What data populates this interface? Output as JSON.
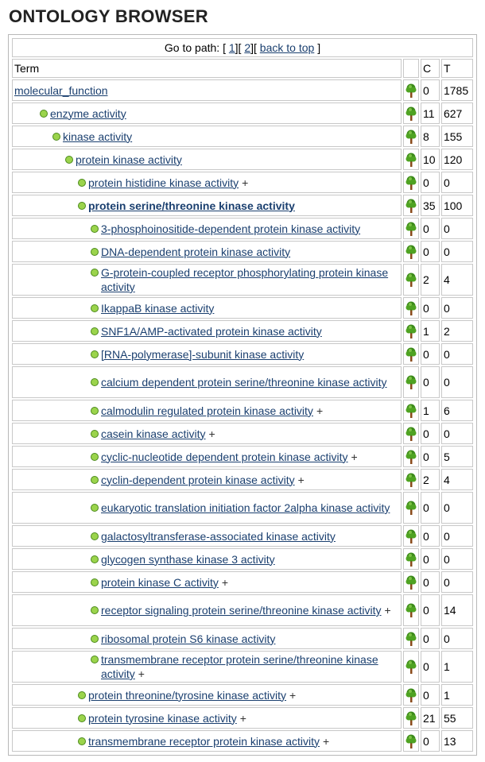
{
  "page_title": "ONTOLOGY BROWSER",
  "goto": {
    "prefix": "Go to path: [",
    "link1": "1",
    "sep1": "][",
    "link2": "2",
    "sep2": "][",
    "back": "back to top",
    "suffix": "]"
  },
  "headers": {
    "term": "Term",
    "tree": "",
    "c": "C",
    "t": "T"
  },
  "rows": [
    {
      "label": "molecular_function",
      "c": "0",
      "t": "1785"
    },
    {
      "label": "enzyme activity",
      "c": "11",
      "t": "627"
    },
    {
      "label": "kinase activity",
      "c": "8",
      "t": "155"
    },
    {
      "label": "protein kinase activity",
      "c": "10",
      "t": "120"
    },
    {
      "label": "protein histidine kinase activity",
      "plus": "+",
      "c": "0",
      "t": "0"
    },
    {
      "label": "protein serine/threonine kinase activity",
      "c": "35",
      "t": "100"
    },
    {
      "label": "3-phosphoinositide-dependent protein kinase activity",
      "c": "0",
      "t": "0"
    },
    {
      "label": "DNA-dependent protein kinase activity",
      "c": "0",
      "t": "0"
    },
    {
      "label": "G-protein-coupled receptor phosphorylating protein kinase activity",
      "c": "2",
      "t": "4"
    },
    {
      "label": "IkappaB kinase activity",
      "c": "0",
      "t": "0"
    },
    {
      "label": "SNF1A/AMP-activated protein kinase activity",
      "c": "1",
      "t": "2"
    },
    {
      "label": "[RNA-polymerase]-subunit kinase activity",
      "c": "0",
      "t": "0"
    },
    {
      "label": "calcium dependent protein serine/threonine kinase activity",
      "c": "0",
      "t": "0"
    },
    {
      "label": "calmodulin regulated protein kinase activity",
      "plus": "+",
      "c": "1",
      "t": "6"
    },
    {
      "label": "casein kinase activity",
      "plus": "+",
      "c": "0",
      "t": "0"
    },
    {
      "label": "cyclic-nucleotide dependent protein kinase activity",
      "plus": "+",
      "c": "0",
      "t": "5"
    },
    {
      "label": "cyclin-dependent protein kinase activity",
      "plus": "+",
      "c": "2",
      "t": "4"
    },
    {
      "label": "eukaryotic translation initiation factor 2alpha kinase activity",
      "c": "0",
      "t": "0"
    },
    {
      "label": "galactosyltransferase-associated kinase activity",
      "c": "0",
      "t": "0"
    },
    {
      "label": "glycogen synthase kinase 3 activity",
      "c": "0",
      "t": "0"
    },
    {
      "label": "protein kinase C activity",
      "plus": "+",
      "c": "0",
      "t": "0"
    },
    {
      "label": "receptor signaling protein serine/threonine kinase activity",
      "plus": "+",
      "c": "0",
      "t": "14"
    },
    {
      "label": "ribosomal protein S6 kinase activity",
      "c": "0",
      "t": "0"
    },
    {
      "label": "transmembrane receptor protein serine/threonine kinase activity",
      "plus": "+",
      "c": "0",
      "t": "1"
    },
    {
      "label": "protein threonine/tyrosine kinase activity",
      "plus": "+",
      "c": "0",
      "t": "1"
    },
    {
      "label": "protein tyrosine kinase activity",
      "plus": "+",
      "c": "21",
      "t": "55"
    },
    {
      "label": "transmembrane receptor protein kinase activity",
      "plus": "+",
      "c": "0",
      "t": "13"
    }
  ],
  "colors": {
    "link": "#1a3f6f",
    "border": "#c8c8c8",
    "tree_green": "#3c8a1a",
    "tree_trunk": "#8a4a1a",
    "info_green": "#9bd44c"
  },
  "icons": {
    "tree": "tree-icon",
    "info": "info-icon"
  }
}
